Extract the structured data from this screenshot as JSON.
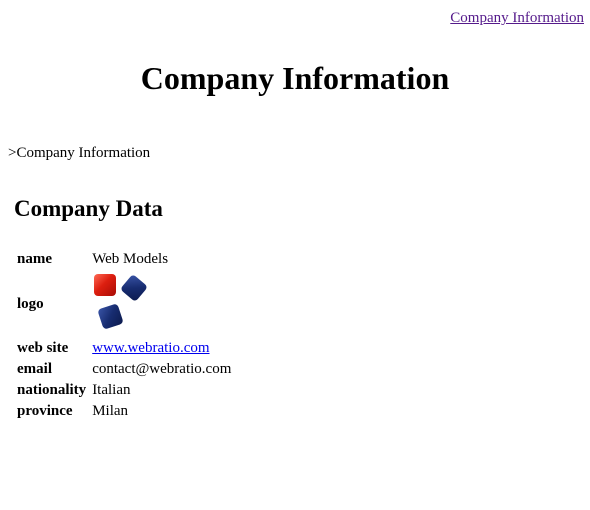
{
  "top_nav": {
    "link_label": "Company Information"
  },
  "page": {
    "title": "Company Information",
    "breadcrumb": ">Company Information"
  },
  "section": {
    "title": "Company Data"
  },
  "fields": {
    "name": {
      "label": "name",
      "value": "Web Models"
    },
    "logo": {
      "label": "logo",
      "icon": "webratio-logo-icon",
      "colors": [
        "#dd1f10",
        "#172c70"
      ]
    },
    "website": {
      "label": "web site",
      "value": "www.webratio.com"
    },
    "email": {
      "label": "email",
      "value": "contact@webratio.com"
    },
    "nationality": {
      "label": "nationality",
      "value": "Italian"
    },
    "province": {
      "label": "province",
      "value": "Milan"
    }
  },
  "colors": {
    "visited_link": "#551a8b",
    "link": "#0000ee"
  }
}
